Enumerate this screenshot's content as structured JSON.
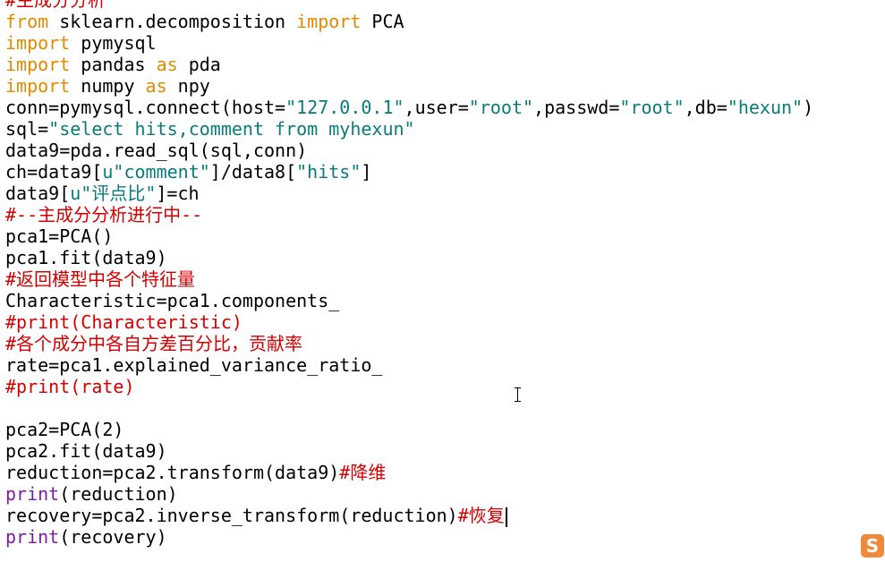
{
  "editor": {
    "lines": [
      [
        {
          "t": "#主成分分析",
          "c": "cm"
        }
      ],
      [
        {
          "t": "from",
          "c": "kw"
        },
        {
          "t": " sklearn.decomposition ",
          "c": "pl"
        },
        {
          "t": "import",
          "c": "kw"
        },
        {
          "t": " PCA",
          "c": "pl"
        }
      ],
      [
        {
          "t": "import",
          "c": "kw"
        },
        {
          "t": " pymysql",
          "c": "pl"
        }
      ],
      [
        {
          "t": "import",
          "c": "kw"
        },
        {
          "t": " pandas ",
          "c": "pl"
        },
        {
          "t": "as",
          "c": "kw"
        },
        {
          "t": " pda",
          "c": "pl"
        }
      ],
      [
        {
          "t": "import",
          "c": "kw"
        },
        {
          "t": " numpy ",
          "c": "pl"
        },
        {
          "t": "as",
          "c": "kw"
        },
        {
          "t": " npy",
          "c": "pl"
        }
      ],
      [
        {
          "t": "conn=pymysql.connect(host=",
          "c": "pl"
        },
        {
          "t": "\"127.0.0.1\"",
          "c": "str"
        },
        {
          "t": ",user=",
          "c": "pl"
        },
        {
          "t": "\"root\"",
          "c": "str"
        },
        {
          "t": ",passwd=",
          "c": "pl"
        },
        {
          "t": "\"root\"",
          "c": "str"
        },
        {
          "t": ",db=",
          "c": "pl"
        },
        {
          "t": "\"hexun\"",
          "c": "str"
        },
        {
          "t": ")",
          "c": "pl"
        }
      ],
      [
        {
          "t": "sql=",
          "c": "pl"
        },
        {
          "t": "\"select hits,comment from myhexun\"",
          "c": "str"
        }
      ],
      [
        {
          "t": "data9=pda.read_sql(sql,conn)",
          "c": "pl"
        }
      ],
      [
        {
          "t": "ch=data9[",
          "c": "pl"
        },
        {
          "t": "u\"comment\"",
          "c": "str"
        },
        {
          "t": "]/data8[",
          "c": "pl"
        },
        {
          "t": "\"hits\"",
          "c": "str"
        },
        {
          "t": "]",
          "c": "pl"
        }
      ],
      [
        {
          "t": "data9[",
          "c": "pl"
        },
        {
          "t": "u\"评点比\"",
          "c": "str"
        },
        {
          "t": "]=ch",
          "c": "pl"
        }
      ],
      [
        {
          "t": "#--主成分分析进行中--",
          "c": "cm"
        }
      ],
      [
        {
          "t": "pca1=PCA()",
          "c": "pl"
        }
      ],
      [
        {
          "t": "pca1.fit(data9)",
          "c": "pl"
        }
      ],
      [
        {
          "t": "#返回模型中各个特征量",
          "c": "cm"
        }
      ],
      [
        {
          "t": "Characteristic=pca1.components_",
          "c": "pl"
        }
      ],
      [
        {
          "t": "#print(Characteristic)",
          "c": "cm"
        }
      ],
      [
        {
          "t": "#各个成分中各自方差百分比，贡献率",
          "c": "cm"
        }
      ],
      [
        {
          "t": "rate=pca1.explained_variance_ratio_",
          "c": "pl"
        }
      ],
      [
        {
          "t": "#print(rate)",
          "c": "cm"
        }
      ],
      [],
      [
        {
          "t": "pca2=PCA(2)",
          "c": "pl"
        }
      ],
      [
        {
          "t": "pca2.fit(data9)",
          "c": "pl"
        }
      ],
      [
        {
          "t": "reduction=pca2.transform(data9)",
          "c": "pl"
        },
        {
          "t": "#降维",
          "c": "cm"
        }
      ],
      [
        {
          "t": "print",
          "c": "fn"
        },
        {
          "t": "(reduction)",
          "c": "pl"
        }
      ],
      [
        {
          "t": "recovery=pca2.inverse_transform(reduction)",
          "c": "pl"
        },
        {
          "t": "#恢复",
          "c": "cm"
        }
      ],
      [
        {
          "t": "print",
          "c": "fn"
        },
        {
          "t": "(recovery)",
          "c": "pl"
        }
      ]
    ],
    "caret_line": 24
  },
  "ime": {
    "glyph": "S"
  },
  "colors": {
    "keyword": "#e08a00",
    "string": "#0a7a7a",
    "comment": "#d40000",
    "builtin": "#7a1fa0"
  }
}
